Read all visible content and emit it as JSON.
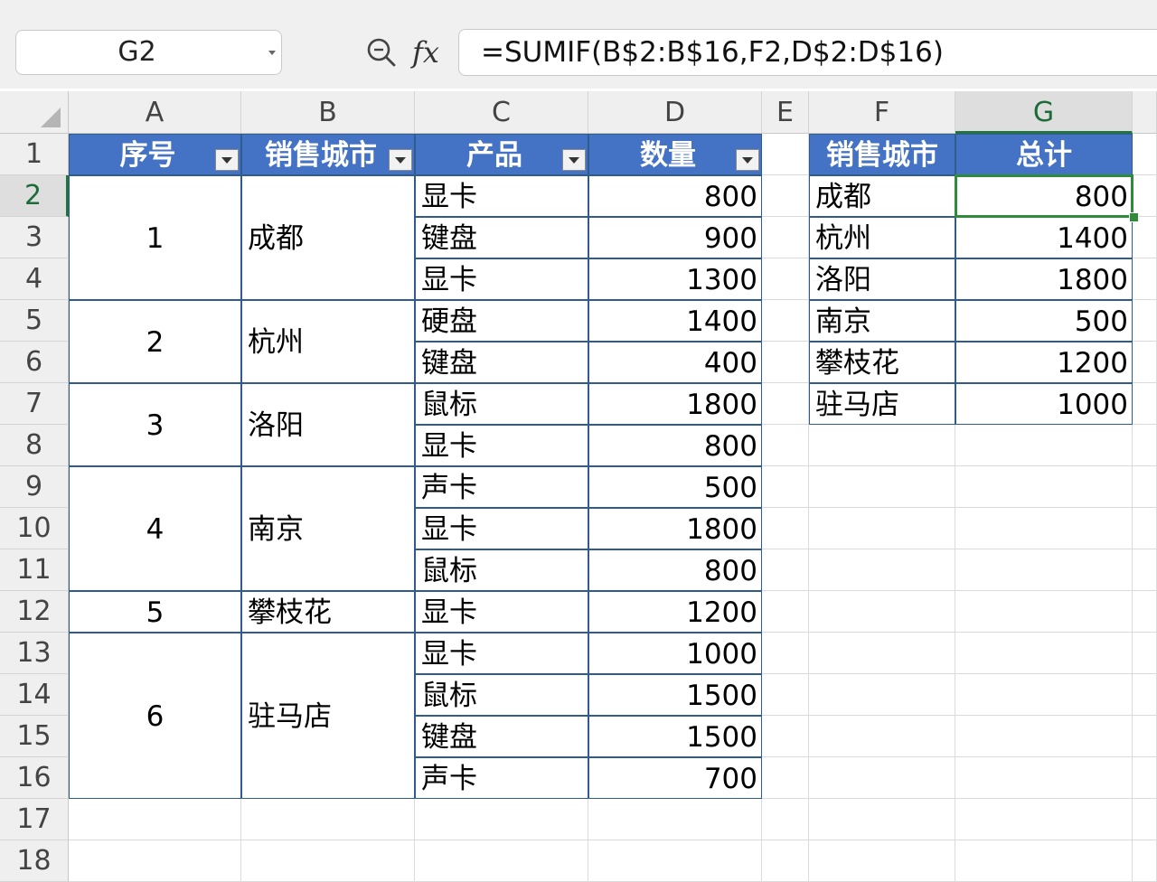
{
  "formula_bar": {
    "name_box": "G2",
    "fx_label": "fx",
    "formula": "=SUMIF(B$2:B$16,F2,D$2:D$16)"
  },
  "icons": {
    "zoom": "zoom-search-icon",
    "dropdown": "chevron-down-icon",
    "filter": "filter-dropdown-icon"
  },
  "colors": {
    "header_fill": "#4472c4",
    "table_border": "#2f5c8a",
    "selection": "#2f8a3c"
  },
  "columns": [
    "A",
    "B",
    "C",
    "D",
    "E",
    "F",
    "G"
  ],
  "rows": [
    "1",
    "2",
    "3",
    "4",
    "5",
    "6",
    "7",
    "8",
    "9",
    "10",
    "11",
    "12",
    "13",
    "14",
    "15",
    "16",
    "17",
    "18"
  ],
  "active_cell": {
    "column": "G",
    "row": "2"
  },
  "table1": {
    "headers": [
      "序号",
      "销售城市",
      "产品",
      "数量"
    ],
    "groups": [
      {
        "index": "1",
        "city": "成都",
        "first_row": 2,
        "last_row": 4
      },
      {
        "index": "2",
        "city": "杭州",
        "first_row": 5,
        "last_row": 6
      },
      {
        "index": "3",
        "city": "洛阳",
        "first_row": 7,
        "last_row": 8
      },
      {
        "index": "4",
        "city": "南京",
        "first_row": 9,
        "last_row": 11
      },
      {
        "index": "5",
        "city": "攀枝花",
        "first_row": 12,
        "last_row": 12
      },
      {
        "index": "6",
        "city": "驻马店",
        "first_row": 13,
        "last_row": 16
      }
    ],
    "items": [
      {
        "product": "显卡",
        "qty": "800"
      },
      {
        "product": "键盘",
        "qty": "900"
      },
      {
        "product": "显卡",
        "qty": "1300"
      },
      {
        "product": "硬盘",
        "qty": "1400"
      },
      {
        "product": "键盘",
        "qty": "400"
      },
      {
        "product": "鼠标",
        "qty": "1800"
      },
      {
        "product": "显卡",
        "qty": "800"
      },
      {
        "product": "声卡",
        "qty": "500"
      },
      {
        "product": "显卡",
        "qty": "1800"
      },
      {
        "product": "鼠标",
        "qty": "800"
      },
      {
        "product": "显卡",
        "qty": "1200"
      },
      {
        "product": "显卡",
        "qty": "1000"
      },
      {
        "product": "鼠标",
        "qty": "1500"
      },
      {
        "product": "键盘",
        "qty": "1500"
      },
      {
        "product": "声卡",
        "qty": "700"
      }
    ]
  },
  "table2": {
    "headers": [
      "销售城市",
      "总计"
    ],
    "rows": [
      {
        "city": "成都",
        "total": "800"
      },
      {
        "city": "杭州",
        "total": "1400"
      },
      {
        "city": "洛阳",
        "total": "1800"
      },
      {
        "city": "南京",
        "total": "500"
      },
      {
        "city": "攀枝花",
        "total": "1200"
      },
      {
        "city": "驻马店",
        "total": "1000"
      }
    ]
  }
}
